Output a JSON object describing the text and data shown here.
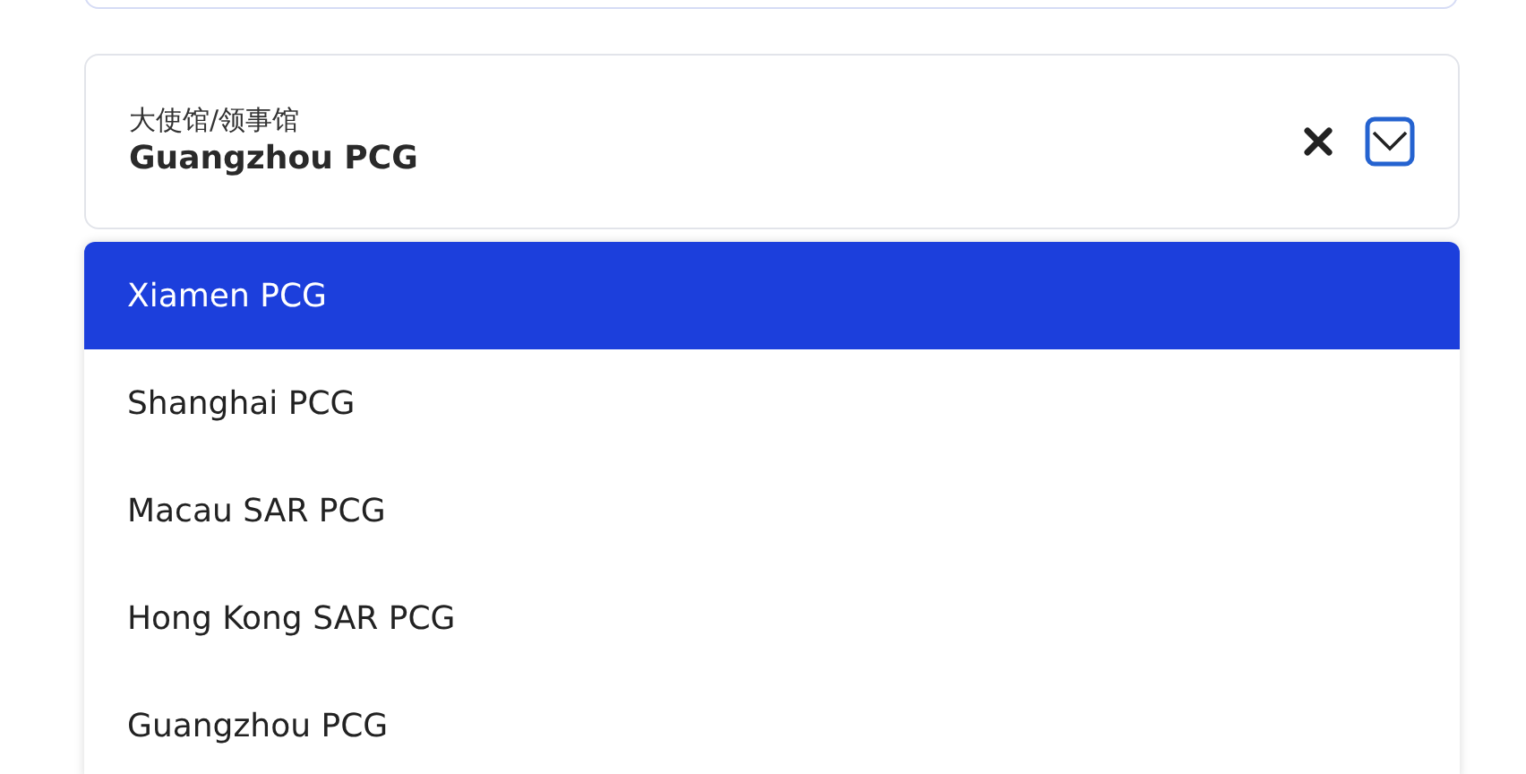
{
  "field": {
    "label": "大使馆/领事馆",
    "value": "Guangzhou PCG"
  },
  "options": [
    {
      "label": "Xiamen PCG",
      "selected": true
    },
    {
      "label": "Shanghai PCG",
      "selected": false
    },
    {
      "label": "Macau SAR PCG",
      "selected": false
    },
    {
      "label": "Hong Kong SAR PCG",
      "selected": false
    },
    {
      "label": "Guangzhou PCG",
      "selected": false
    }
  ]
}
